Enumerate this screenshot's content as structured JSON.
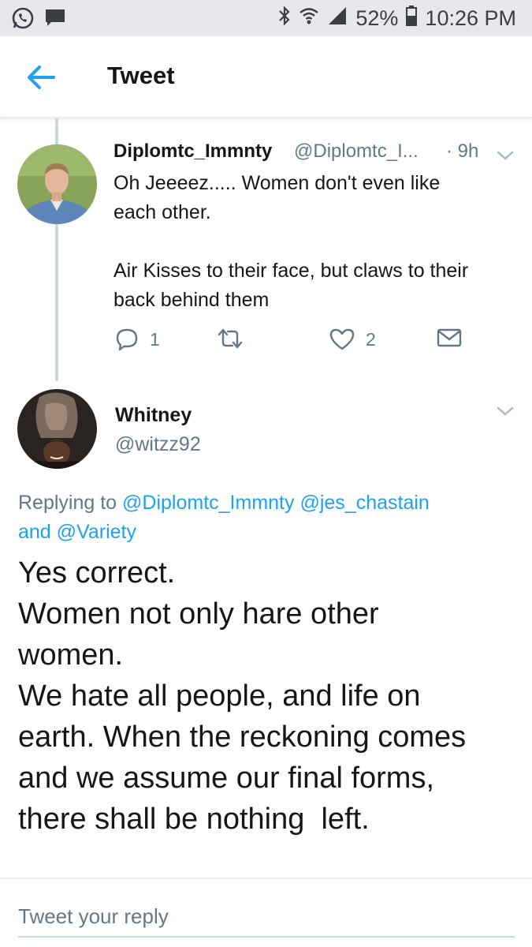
{
  "status_bar": {
    "battery": "52%",
    "time": "10:26 PM",
    "icons": [
      "whatsapp-icon",
      "message-icon",
      "bluetooth-icon",
      "wifi-icon",
      "signal-icon",
      "battery-icon"
    ]
  },
  "header": {
    "title": "Tweet",
    "back_icon": "back-arrow-icon"
  },
  "tweets": [
    {
      "name": "Diplomtc_Immnty",
      "handle": "@Diplomtc_I...",
      "time": "· 9h",
      "text_lines": [
        "Oh Jeeeez..... Women don't even like",
        "each other.",
        "",
        "Air Kisses to their face, but claws to their",
        "back behind them"
      ],
      "replies": "1",
      "retweets": "",
      "likes": "2"
    },
    {
      "name": "Whitney",
      "handle": "@witzz92",
      "replying_prefix": "Replying to",
      "replying_to": [
        "@Diplomtc_Immnty",
        "@jes_chastain"
      ],
      "replying_and": "and",
      "replying_last": "@Variety",
      "text_lines": [
        "Yes correct.",
        "Women not only hare other",
        "women.",
        "We hate all people, and life on",
        "earth. When the reckoning comes",
        "and we assume our final forms,",
        "there shall be nothing  left."
      ]
    }
  ],
  "reply": {
    "placeholder": "Tweet your reply"
  },
  "colors": {
    "accent": "#1da1f2",
    "secondary_text": "#657786",
    "status_bar_bg": "#e6e8ec"
  }
}
